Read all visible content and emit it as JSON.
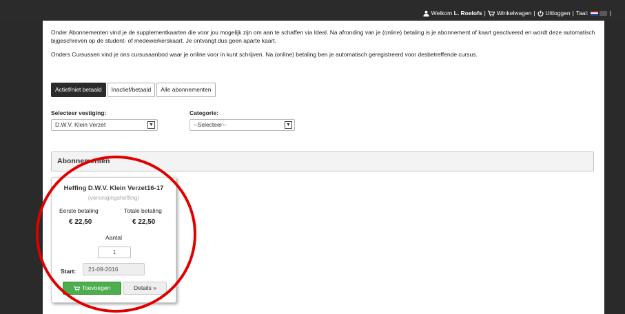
{
  "topbar": {
    "welcome_prefix": "Welkom",
    "user_name": "L. Roelofs",
    "cart_label": "Winkelwagen",
    "logout_label": "Uitloggen",
    "language_label": "Taal:",
    "separator": "|",
    "icons": [
      "user-icon",
      "cart-icon",
      "power-icon",
      "flag-nl-icon",
      "flag-en-icon"
    ]
  },
  "intro": {
    "paragraph1": "Onder Abonnementen vind je de supplementkaarten die voor jou mogelijk zijn om aan te schaffen via Ideal. Na afronding van je (online) betaling is je abonnement of kaart geactiveerd en wordt deze automatisch bijgeschreven op de student- of medewerkerskaart. Je ontvangt dus geen aparte kaart.",
    "paragraph2": "Onders Cursussen vind je ons cursusaanbod waar je online voor in kunt schrijven. Na (online) betaling ben je automatisch geregistreerd voor desbetreffende  cursus."
  },
  "tabs": [
    {
      "label": "Actief/niet betaald",
      "active": true
    },
    {
      "label": "Inactief/betaald",
      "active": false
    },
    {
      "label": "Alle abonnementen",
      "active": false
    }
  ],
  "filters": {
    "location_label": "Selecteer vestiging:",
    "location_value": "D.W.V. Klein Verzet",
    "category_label": "Categorie:",
    "category_value": "--Selecteer--"
  },
  "section": {
    "title": "Abonnementen"
  },
  "card": {
    "title": "Heffing D.W.V. Klein Verzet16-17",
    "subtitle": "(verenigingsheffing)",
    "first_payment_label": "Eerste betaling",
    "first_payment_value": "€ 22,50",
    "total_payment_label": "Totale betaling",
    "total_payment_value": "€ 22,50",
    "quantity_label": "Aantal",
    "quantity_value": "1",
    "start_label": "Start:",
    "start_value": "21-09-2016",
    "add_button": "Toevoegen",
    "details_button": "Details »"
  },
  "colors": {
    "topbar": "#2b2b2b",
    "active_tab": "#2b2b2b",
    "add_button": "#4cae4c",
    "highlight_circle": "#e00000"
  }
}
